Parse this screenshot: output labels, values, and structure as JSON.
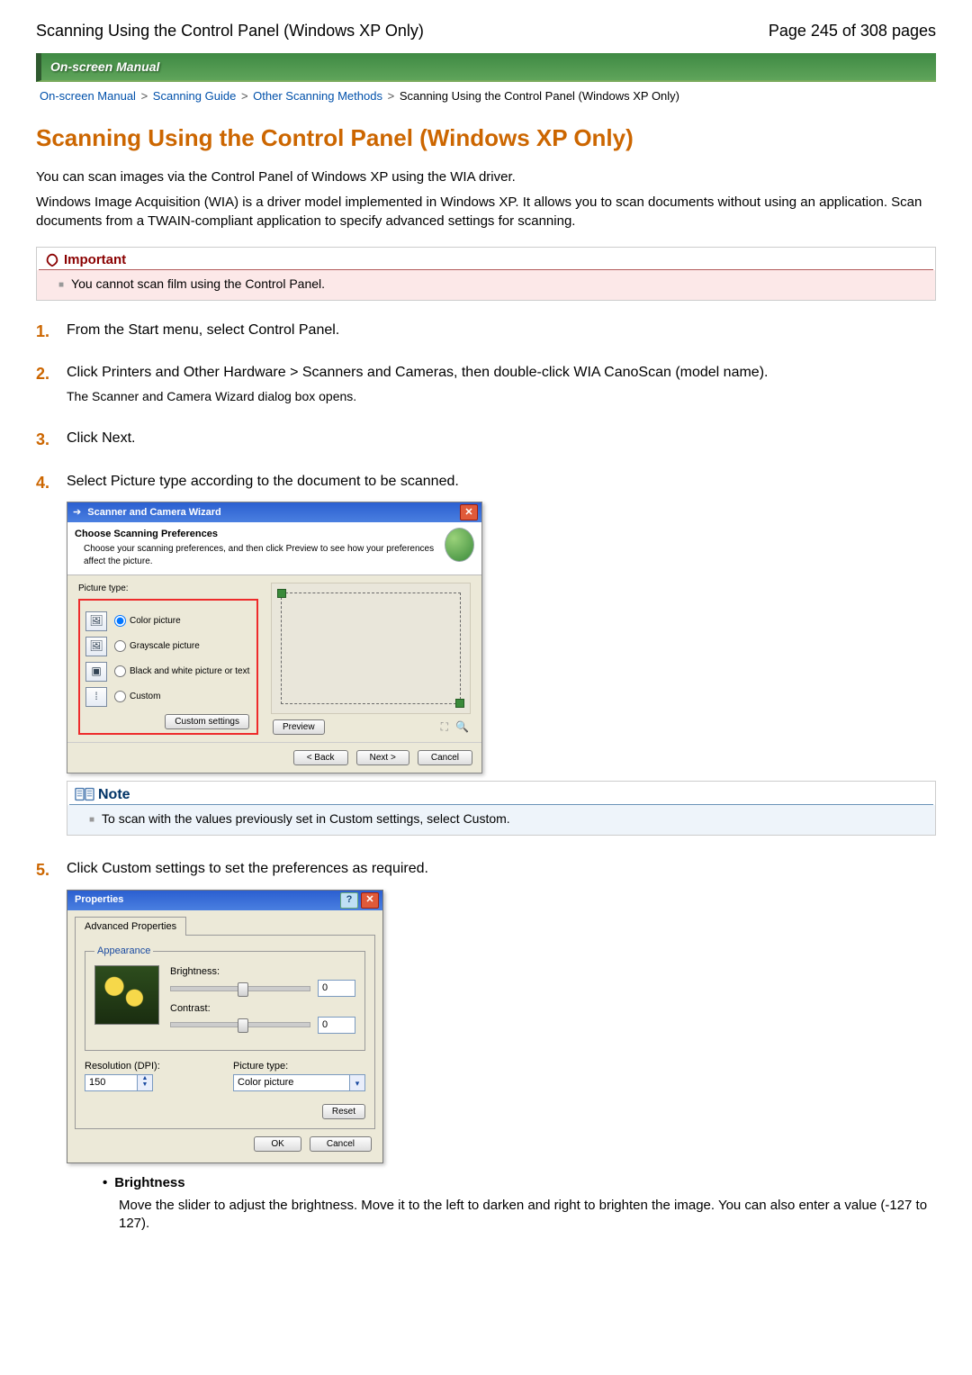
{
  "header": {
    "left": "Scanning Using the Control Panel (Windows XP Only)",
    "right": "Page 245 of 308 pages"
  },
  "banner": "On-screen Manual",
  "breadcrumb": {
    "items": [
      "On-screen Manual",
      "Scanning Guide",
      "Other Scanning Methods"
    ],
    "current": "Scanning Using the Control Panel (Windows XP Only)",
    "sep": ">"
  },
  "title": "Scanning Using the Control Panel (Windows XP Only)",
  "intro": [
    "You can scan images via the Control Panel of Windows XP using the WIA driver.",
    "Windows Image Acquisition (WIA) is a driver model implemented in Windows XP. It allows you to scan documents without using an application. Scan documents from a TWAIN-compliant application to specify advanced settings for scanning."
  ],
  "important": {
    "label": "Important",
    "text": "You cannot scan film using the Control Panel."
  },
  "steps": {
    "1": {
      "text": "From the Start menu, select Control Panel."
    },
    "2": {
      "text": "Click Printers and Other Hardware > Scanners and Cameras, then double-click WIA CanoScan (model name).",
      "sub": "The Scanner and Camera Wizard dialog box opens."
    },
    "3": {
      "text": "Click Next."
    },
    "4": {
      "text": "Select Picture type according to the document to be scanned."
    },
    "5": {
      "text": "Click Custom settings to set the preferences as required."
    }
  },
  "wizard": {
    "title": "Scanner and Camera Wizard",
    "head": {
      "bold": "Choose Scanning Preferences",
      "sub": "Choose your scanning preferences, and then click Preview to see how your preferences affect the picture."
    },
    "group_label": "Picture type:",
    "options": [
      {
        "label": "Color picture",
        "glyph": "🖼"
      },
      {
        "label": "Grayscale picture",
        "glyph": "🖼"
      },
      {
        "label": "Black and white picture or text",
        "glyph": "▣"
      },
      {
        "label": "Custom",
        "glyph": "⁞"
      }
    ],
    "custom_settings_btn": "Custom settings",
    "preview_btn": "Preview",
    "buttons": {
      "back": "< Back",
      "next": "Next >",
      "cancel": "Cancel"
    }
  },
  "note": {
    "label": "Note",
    "text": "To scan with the values previously set in Custom settings, select Custom."
  },
  "props": {
    "title": "Properties",
    "tab": "Advanced Properties",
    "legend": "Appearance",
    "brightness_label": "Brightness:",
    "brightness_value": "0",
    "contrast_label": "Contrast:",
    "contrast_value": "0",
    "resolution_label": "Resolution (DPI):",
    "resolution_value": "150",
    "picture_type_label": "Picture type:",
    "picture_type_value": "Color picture",
    "reset": "Reset",
    "ok": "OK",
    "cancel": "Cancel"
  },
  "definition": {
    "term": "Brightness",
    "desc": "Move the slider to adjust the brightness. Move it to the left to darken and right to brighten the image. You can also enter a value (-127 to 127)."
  }
}
